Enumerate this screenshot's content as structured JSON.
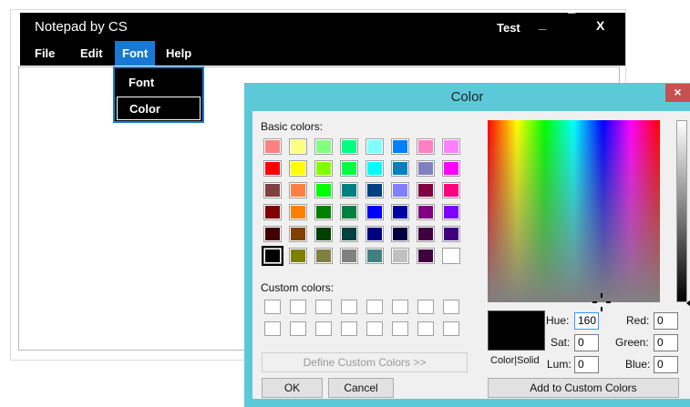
{
  "notepad": {
    "title": "Notepad by CS",
    "title_user": "Test",
    "min_label": "_",
    "max_label": "¯",
    "close_label": "X",
    "menu": [
      "File",
      "Edit",
      "Font",
      "Help"
    ],
    "font_menu": [
      "Font",
      "Color"
    ]
  },
  "color_dialog": {
    "title": "Color",
    "close_label": "×",
    "basic_colors_label": "Basic colors:",
    "custom_colors_label": "Custom colors:",
    "define_custom_label": "Define Custom Colors >>",
    "ok_label": "OK",
    "cancel_label": "Cancel",
    "add_custom_label": "Add to Custom Colors",
    "color_solid_label": "Color|Solid",
    "hue_label": "Hue:",
    "sat_label": "Sat:",
    "lum_label": "Lum:",
    "red_label": "Red:",
    "green_label": "Green:",
    "blue_label": "Blue:",
    "hue": "160",
    "sat": "0",
    "lum": "0",
    "red": "0",
    "green": "0",
    "blue": "0",
    "basic_colors": [
      [
        "#ff8080",
        "#ffff80",
        "#80ff80",
        "#00ff80",
        "#80ffff",
        "#0080ff",
        "#ff80c0",
        "#ff80ff"
      ],
      [
        "#ff0000",
        "#ffff00",
        "#80ff00",
        "#00ff40",
        "#00ffff",
        "#0080c0",
        "#8080c0",
        "#ff00ff"
      ],
      [
        "#804040",
        "#ff8040",
        "#00ff00",
        "#008080",
        "#004080",
        "#8080ff",
        "#800040",
        "#ff0080"
      ],
      [
        "#800000",
        "#ff8000",
        "#008000",
        "#008040",
        "#0000ff",
        "#0000a0",
        "#800080",
        "#8000ff"
      ],
      [
        "#400000",
        "#804000",
        "#004000",
        "#004040",
        "#000080",
        "#000040",
        "#400040",
        "#400080"
      ],
      [
        "#000000",
        "#808000",
        "#808040",
        "#808080",
        "#408080",
        "#c0c0c0",
        "#400040",
        "#ffffff"
      ]
    ],
    "selected_color": "#000000"
  }
}
